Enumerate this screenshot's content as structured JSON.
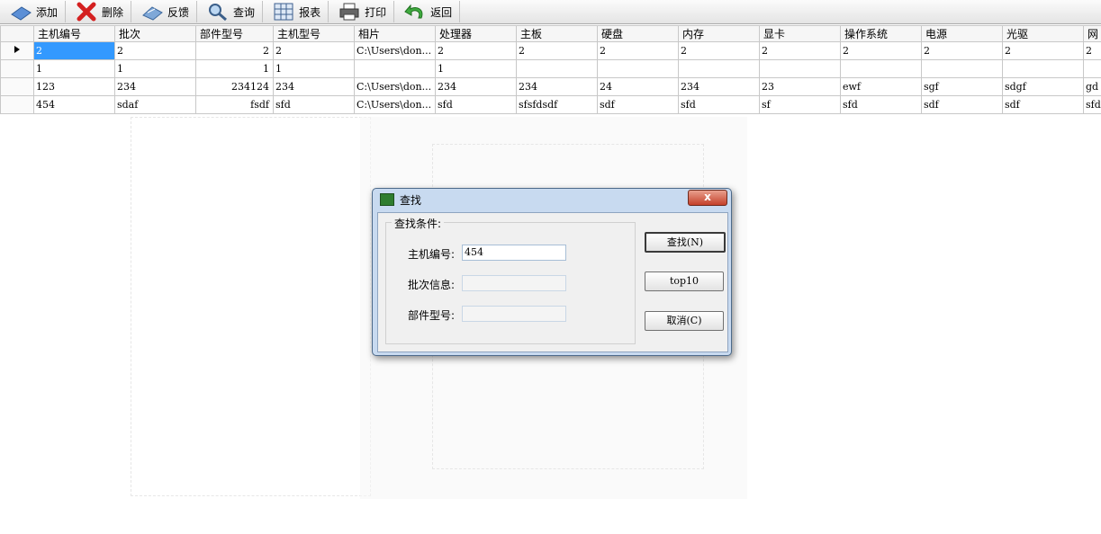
{
  "toolbar": {
    "add": "添加",
    "delete": "删除",
    "feedback": "反馈",
    "query": "查询",
    "report": "报表",
    "print": "打印",
    "back": "返回"
  },
  "grid": {
    "columns": [
      "主机编号",
      "批次",
      "部件型号",
      "主机型号",
      "相片",
      "处理器",
      "主板",
      "硬盘",
      "内存",
      "显卡",
      "操作系统",
      "电源",
      "光驱",
      "网"
    ],
    "rows": [
      [
        "2",
        "2",
        "2",
        "2",
        "C:\\Users\\don...",
        "2",
        "2",
        "2",
        "2",
        "2",
        "2",
        "2",
        "2",
        "2"
      ],
      [
        "1",
        "1",
        "1",
        "1",
        "",
        "1",
        "",
        "",
        "",
        "",
        "",
        "",
        "",
        ""
      ],
      [
        "123",
        "234",
        "234124",
        "234",
        "C:\\Users\\don...",
        "234",
        "234",
        "24",
        "234",
        "23",
        "ewf",
        "sgf",
        "sdgf",
        "gd"
      ],
      [
        "454",
        "sdaf",
        "fsdf",
        "sfd",
        "C:\\Users\\don...",
        "sfd",
        "sfsfdsdf",
        "sdf",
        "sfd",
        "sf",
        "sfd",
        "sdf",
        "sdf",
        "sfd"
      ]
    ]
  },
  "dialog": {
    "title": "查找",
    "close": "x",
    "group_label": "查找条件:",
    "host_id_label": "主机编号:",
    "host_id_value": "454",
    "batch_label": "批次信息:",
    "batch_value": "",
    "part_model_label": "部件型号:",
    "part_model_value": "",
    "find_button": "查找(N)",
    "top10_button": "top10",
    "cancel_button": "取消(C)"
  }
}
